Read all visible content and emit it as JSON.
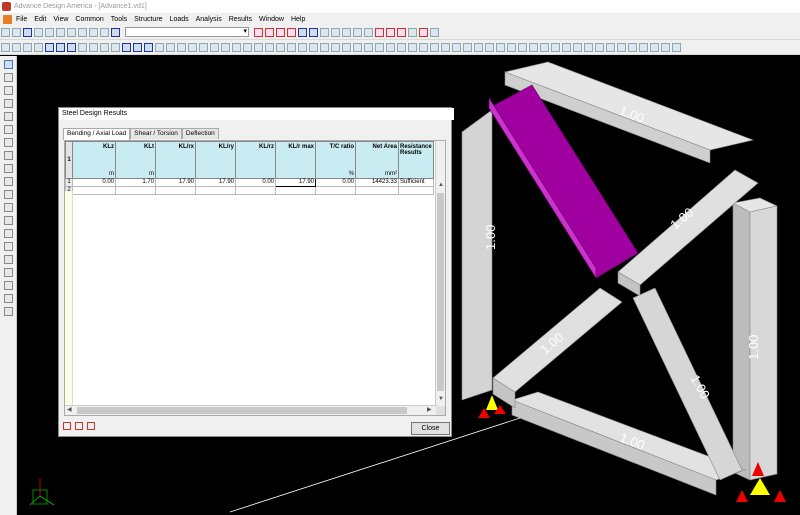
{
  "window": {
    "title": "Advance Design America - [Advance1.vd1]"
  },
  "menu": [
    "File",
    "Edit",
    "View",
    "Common",
    "Tools",
    "Structure",
    "Loads",
    "Analysis",
    "Results",
    "Window",
    "Help"
  ],
  "toolbar": {
    "combo_value": ""
  },
  "scene": {
    "member_labels": [
      "1.00",
      "1.00",
      "1.00",
      "1.00",
      "1.00",
      "1.00",
      "1.00"
    ],
    "colors": {
      "member": "#d3d3d3",
      "selected": "#990099",
      "background": "#000000"
    }
  },
  "dialog": {
    "title": "Steel Design Results",
    "tabs": [
      "Bending / Axial Load",
      "Shear / Torsion",
      "Deflection"
    ],
    "columns": [
      {
        "label": "KLz",
        "unit": "m"
      },
      {
        "label": "KLt",
        "unit": "m"
      },
      {
        "label": "KL/rx",
        "unit": ""
      },
      {
        "label": "KL/ry",
        "unit": ""
      },
      {
        "label": "KL/rz",
        "unit": ""
      },
      {
        "label": "KL/r max",
        "unit": ""
      },
      {
        "label": "T/C ratio",
        "unit": "%"
      },
      {
        "label": "Net Area",
        "unit": "mm²"
      },
      {
        "label": "Resistance Results",
        "unit": ""
      }
    ],
    "header_row_num": "1",
    "rows": [
      {
        "num": "1",
        "cells": [
          "0.00",
          "1.70",
          "17.90",
          "17.90",
          "0.00",
          "17.90",
          "0.00",
          "14423.33",
          "Sufficient"
        ]
      },
      {
        "num": "2",
        "cells": [
          "",
          "",
          "",
          "",
          "",
          "",
          "",
          "",
          ""
        ]
      }
    ],
    "close_label": "Close"
  }
}
